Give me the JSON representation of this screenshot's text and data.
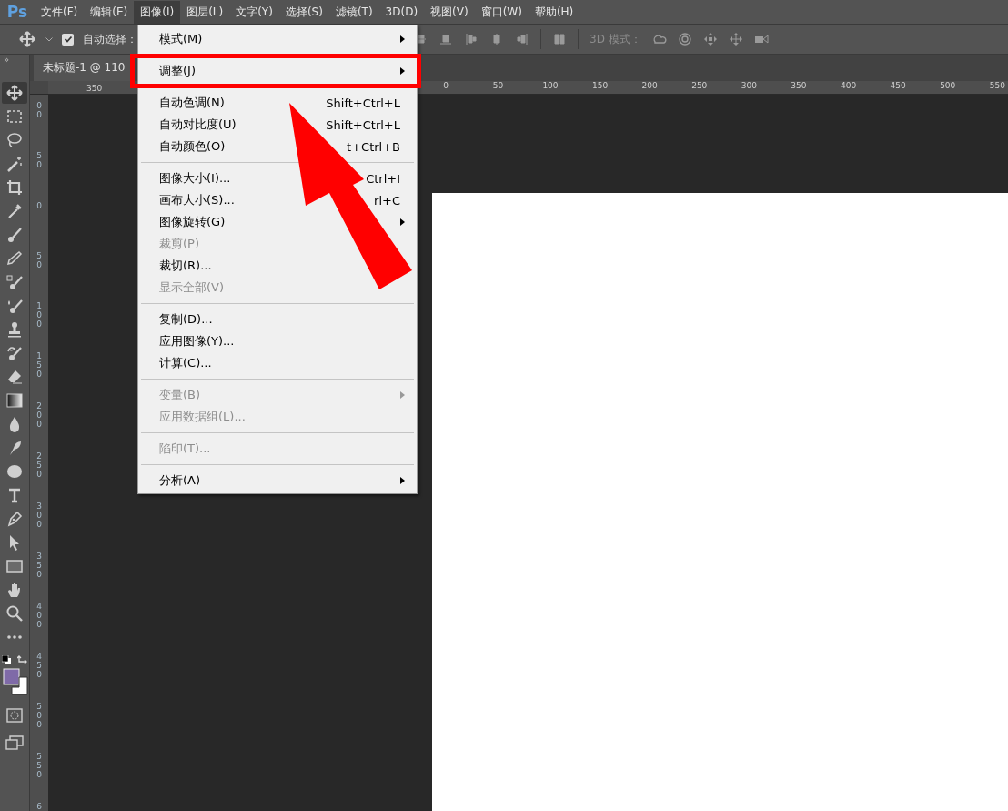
{
  "app": {
    "logo": "Ps"
  },
  "menu_bar": [
    {
      "label": "文件(F)",
      "selected": false
    },
    {
      "label": "编辑(E)",
      "selected": false
    },
    {
      "label": "图像(I)",
      "selected": true
    },
    {
      "label": "图层(L)",
      "selected": false
    },
    {
      "label": "文字(Y)",
      "selected": false
    },
    {
      "label": "选择(S)",
      "selected": false
    },
    {
      "label": "滤镜(T)",
      "selected": false
    },
    {
      "label": "3D(D)",
      "selected": false
    },
    {
      "label": "视图(V)",
      "selected": false
    },
    {
      "label": "窗口(W)",
      "selected": false
    },
    {
      "label": "帮助(H)",
      "selected": false
    }
  ],
  "options_bar": {
    "auto_select": {
      "label": "自动选择：",
      "checked": true
    },
    "mode_label": "3D 模式："
  },
  "panel_collapse": "»",
  "document_tab": {
    "title": "未标题-1 @ 110",
    "selected": true
  },
  "ruler": {
    "left_labels": [
      "350"
    ],
    "right_labels": [
      "0",
      "50",
      "100",
      "150",
      "200",
      "250",
      "300",
      "350",
      "400",
      "450",
      "500",
      "550"
    ],
    "vertical_labels": [
      "00",
      "50",
      "0",
      "50",
      "100",
      "150",
      "200",
      "250",
      "300",
      "350",
      "400",
      "450",
      "500",
      "550",
      "6"
    ]
  },
  "tools": [
    {
      "kind": "move",
      "selected": true
    },
    {
      "kind": "marquee",
      "selected": false
    },
    {
      "kind": "lasso",
      "selected": false
    },
    {
      "kind": "wand",
      "selected": false
    },
    {
      "kind": "crop",
      "selected": false
    },
    {
      "kind": "eyedropper",
      "selected": false
    },
    {
      "kind": "brush",
      "selected": false
    },
    {
      "kind": "pencil",
      "selected": false
    },
    {
      "kind": "replace",
      "selected": false
    },
    {
      "kind": "mixer",
      "selected": false
    },
    {
      "kind": "stamp",
      "selected": false
    },
    {
      "kind": "history",
      "selected": false
    },
    {
      "kind": "eraser",
      "selected": false
    },
    {
      "kind": "gradient",
      "selected": false
    },
    {
      "kind": "blur",
      "selected": false
    },
    {
      "kind": "smudge",
      "selected": false
    },
    {
      "kind": "sponge",
      "selected": false
    },
    {
      "kind": "type",
      "selected": false
    },
    {
      "kind": "pen",
      "selected": false
    },
    {
      "kind": "select",
      "selected": false
    },
    {
      "kind": "rectangle",
      "selected": false
    },
    {
      "kind": "hand",
      "selected": false
    },
    {
      "kind": "zoom",
      "selected": false
    },
    {
      "kind": "more",
      "selected": false
    }
  ],
  "swatches": [
    {
      "kind": "foreground",
      "color": "#7f6aa8"
    },
    {
      "kind": "background",
      "color": "#ffffff"
    }
  ],
  "image_menu": [
    {
      "kind": "item",
      "label": "模式(M)",
      "submenu": true,
      "disabled": false,
      "highlighted": false
    },
    {
      "kind": "separator"
    },
    {
      "kind": "item",
      "label": "调整(J)",
      "submenu": true,
      "disabled": false,
      "highlighted": true
    },
    {
      "kind": "separator"
    },
    {
      "kind": "item",
      "label": "自动色调(N)",
      "shortcut": "Shift+Ctrl+L",
      "submenu": false,
      "disabled": false,
      "highlighted": false
    },
    {
      "kind": "item",
      "label": "自动对比度(U)",
      "shortcut": "Shift+Ctrl+L",
      "submenu": false,
      "disabled": false,
      "highlighted": false
    },
    {
      "kind": "item",
      "label": "自动颜色(O)",
      "shortcut": "t+Ctrl+B",
      "submenu": false,
      "disabled": false,
      "highlighted": false
    },
    {
      "kind": "separator"
    },
    {
      "kind": "item",
      "label": "图像大小(I)...",
      "shortcut": "Ctrl+I",
      "submenu": false,
      "disabled": false,
      "highlighted": false
    },
    {
      "kind": "item",
      "label": "画布大小(S)...",
      "shortcut": "rl+C",
      "submenu": false,
      "disabled": false,
      "highlighted": false
    },
    {
      "kind": "item",
      "label": "图像旋转(G)",
      "submenu": true,
      "disabled": false,
      "highlighted": false
    },
    {
      "kind": "item",
      "label": "裁剪(P)",
      "submenu": false,
      "disabled": true,
      "highlighted": false
    },
    {
      "kind": "item",
      "label": "裁切(R)...",
      "submenu": false,
      "disabled": false,
      "highlighted": false
    },
    {
      "kind": "item",
      "label": "显示全部(V)",
      "submenu": false,
      "disabled": true,
      "highlighted": false
    },
    {
      "kind": "separator"
    },
    {
      "kind": "item",
      "label": "复制(D)...",
      "submenu": false,
      "disabled": false,
      "highlighted": false
    },
    {
      "kind": "item",
      "label": "应用图像(Y)...",
      "submenu": false,
      "disabled": false,
      "highlighted": false
    },
    {
      "kind": "item",
      "label": "计算(C)...",
      "submenu": false,
      "disabled": false,
      "highlighted": false
    },
    {
      "kind": "separator"
    },
    {
      "kind": "item",
      "label": "变量(B)",
      "submenu": true,
      "disabled": true,
      "highlighted": false
    },
    {
      "kind": "item",
      "label": "应用数据组(L)...",
      "submenu": false,
      "disabled": true,
      "highlighted": false
    },
    {
      "kind": "separator"
    },
    {
      "kind": "item",
      "label": "陷印(T)...",
      "submenu": false,
      "disabled": true,
      "highlighted": false
    },
    {
      "kind": "separator"
    },
    {
      "kind": "item",
      "label": "分析(A)",
      "submenu": true,
      "disabled": false,
      "highlighted": false
    }
  ]
}
